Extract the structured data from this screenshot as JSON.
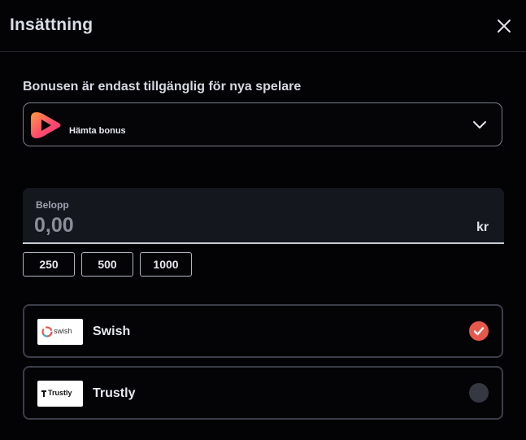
{
  "header": {
    "title": "Insättning",
    "close_icon": "close-icon"
  },
  "bonus": {
    "note": "Bonusen är endast tillgänglig för nya spelare",
    "selected_label": "Hämta bonus",
    "logo_icon": "play-logo-icon",
    "dropdown_icon": "chevron-down-icon"
  },
  "amount": {
    "label": "Belopp",
    "value": "",
    "placeholder": "0,00",
    "currency": "kr"
  },
  "quick_amounts": [
    "250",
    "500",
    "1000"
  ],
  "payment_methods": [
    {
      "name": "Swish",
      "logo_text": "swish",
      "selected": true
    },
    {
      "name": "Trustly",
      "logo_text": "Trustly",
      "selected": false
    }
  ],
  "colors": {
    "background": "#030305",
    "accent": "#e8574c",
    "input_bg": "#15171f",
    "border": "#3b3e48"
  }
}
